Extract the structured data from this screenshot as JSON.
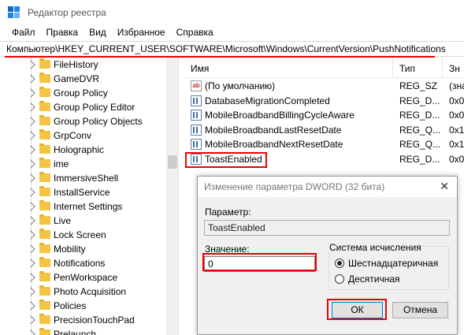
{
  "window": {
    "title": "Редактор реестра"
  },
  "menu": [
    "Файл",
    "Правка",
    "Вид",
    "Избранное",
    "Справка"
  ],
  "address": "Компьютер\\HKEY_CURRENT_USER\\SOFTWARE\\Microsoft\\Windows\\CurrentVersion\\PushNotifications",
  "tree": [
    "FileHistory",
    "GameDVR",
    "Group Policy",
    "Group Policy Editor",
    "Group Policy Objects",
    "GrpConv",
    "Holographic",
    "ime",
    "ImmersiveShell",
    "InstallService",
    "Internet Settings",
    "Live",
    "Lock Screen",
    "Mobility",
    "Notifications",
    "PenWorkspace",
    "Photo Acquisition",
    "Policies",
    "PrecisionTouchPad",
    "Prelaunch"
  ],
  "list": {
    "headers": {
      "name": "Имя",
      "type": "Тип",
      "value": "Зн"
    },
    "rows": [
      {
        "icon": "ab",
        "name": "(По умолчанию)",
        "type": "REG_SZ",
        "value": "(зна"
      },
      {
        "icon": "bin",
        "name": "DatabaseMigrationCompleted",
        "type": "REG_D...",
        "value": "0x0"
      },
      {
        "icon": "bin",
        "name": "MobileBroadbandBillingCycleAware",
        "type": "REG_D...",
        "value": "0x0"
      },
      {
        "icon": "bin",
        "name": "MobileBroadbandLastResetDate",
        "type": "REG_Q...",
        "value": "0x1"
      },
      {
        "icon": "bin",
        "name": "MobileBroadbandNextResetDate",
        "type": "REG_Q...",
        "value": "0x1"
      },
      {
        "icon": "bin",
        "name": "ToastEnabled",
        "type": "REG_D...",
        "value": "0x0"
      }
    ]
  },
  "dialog": {
    "title": "Изменение параметра DWORD (32 бита)",
    "close": "✕",
    "param_label": "Параметр:",
    "param_value": "ToastEnabled",
    "value_label": "Значение:",
    "value": "0",
    "base_label": "Система исчисления",
    "hex_label": "Шестнадцатеричная",
    "dec_label": "Десятичная",
    "ok": "ОК",
    "cancel": "Отмена"
  },
  "colors": {
    "highlight": "#ee0000",
    "accent": "#0078d7"
  }
}
